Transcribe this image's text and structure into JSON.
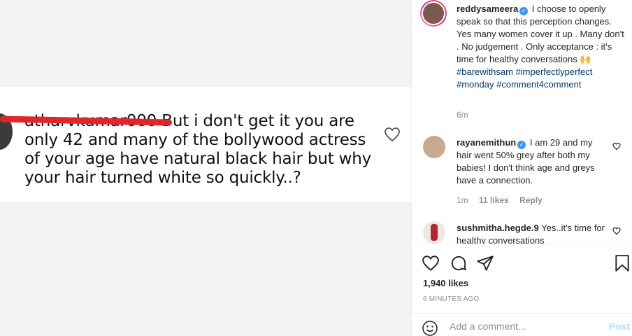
{
  "image_comment": {
    "username": "atharvkumar000",
    "text": "But i don't get it you are only 42 and many of the bollywood actress of your age have natural black hair but why your hair turned white so quickly..?"
  },
  "caption": {
    "username": "reddysameera",
    "verified_mark": "✓",
    "text": "I choose to openly speak so that this perception changes. Yes many women cover it up . Many don't . No judgement . Only acceptance : it's time for healthy conversations",
    "emoji": "🙌",
    "hashtags": [
      "#barewithsam",
      "#imperfectlyperfect",
      "#monday",
      "#comment4comment"
    ],
    "time": "6m"
  },
  "comments": [
    {
      "username": "rayanemithun",
      "verified_mark": "✓",
      "text": "I am 29 and my hair went 50% grey after both my babies! I don't think age and greys have a connection.",
      "time": "1m",
      "likes": "11 likes",
      "reply": "Reply"
    },
    {
      "username": "sushmitha.hegde.9",
      "text": "Yes..it's time for healthy conversations"
    }
  ],
  "post": {
    "likes": "1,940 likes",
    "time_ago": "6 MINUTES AGO"
  },
  "add_comment": {
    "placeholder": "Add a comment...",
    "post_label": "Post"
  },
  "icons": {
    "like": "heart-icon",
    "comment": "comment-icon",
    "share": "paper-plane-icon",
    "save": "bookmark-icon",
    "emoji": "emoji-icon"
  }
}
